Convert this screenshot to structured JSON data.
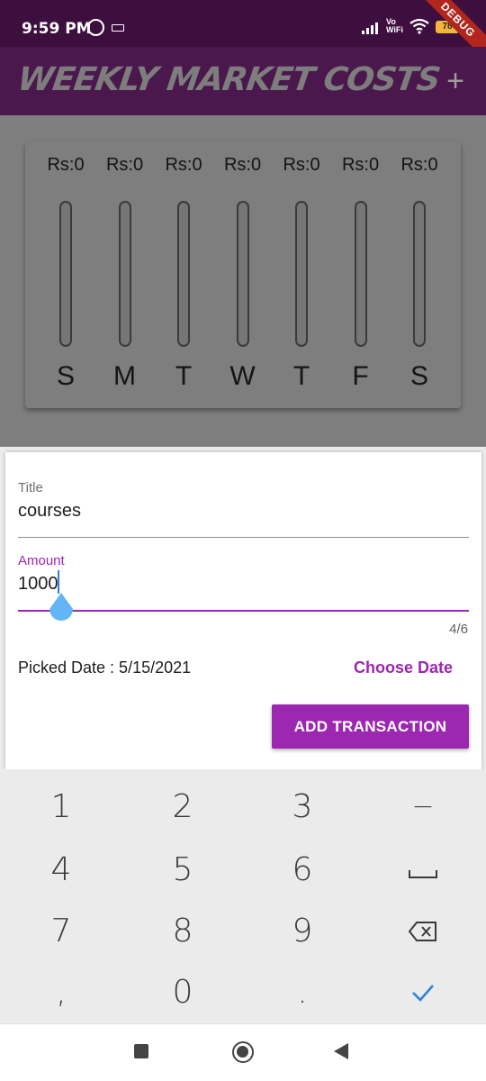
{
  "status_bar": {
    "time": "9:59 PM",
    "vo_wifi_top": "Vo",
    "vo_wifi_bottom": "WiFi",
    "battery": "78",
    "debug_banner": "DEBUG"
  },
  "app_bar": {
    "title": "WEEKLY MARKET COSTS",
    "add_icon": "+"
  },
  "chart": {
    "days": [
      {
        "day": "S",
        "amount": "Rs:0",
        "fraction": 0
      },
      {
        "day": "M",
        "amount": "Rs:0",
        "fraction": 0
      },
      {
        "day": "T",
        "amount": "Rs:0",
        "fraction": 0
      },
      {
        "day": "W",
        "amount": "Rs:0",
        "fraction": 0
      },
      {
        "day": "T",
        "amount": "Rs:0",
        "fraction": 0
      },
      {
        "day": "F",
        "amount": "Rs:0",
        "fraction": 0
      },
      {
        "day": "S",
        "amount": "Rs:0",
        "fraction": 0
      }
    ]
  },
  "form": {
    "title_label": "Title",
    "title_value": "courses",
    "amount_label": "Amount",
    "amount_value": "1000",
    "counter": "4/6",
    "picked_date": "Picked Date : 5/15/2021",
    "choose_date": "Choose Date",
    "add_transaction": "ADD TRANSACTION"
  },
  "keyboard": {
    "row1": [
      "1",
      "2",
      "3",
      "−"
    ],
    "row2": [
      "4",
      "5",
      "6",
      "space-icon"
    ],
    "row3": [
      "7",
      "8",
      "9",
      "backspace-icon"
    ],
    "row4": [
      ",",
      "0",
      ".",
      "check-icon"
    ]
  },
  "colors": {
    "accent": "#9c27b0",
    "app_bar": "#4b184e",
    "status_bar": "#3d0f3f",
    "cursor_handle": "#64b5f6",
    "check": "#2f80d6"
  }
}
